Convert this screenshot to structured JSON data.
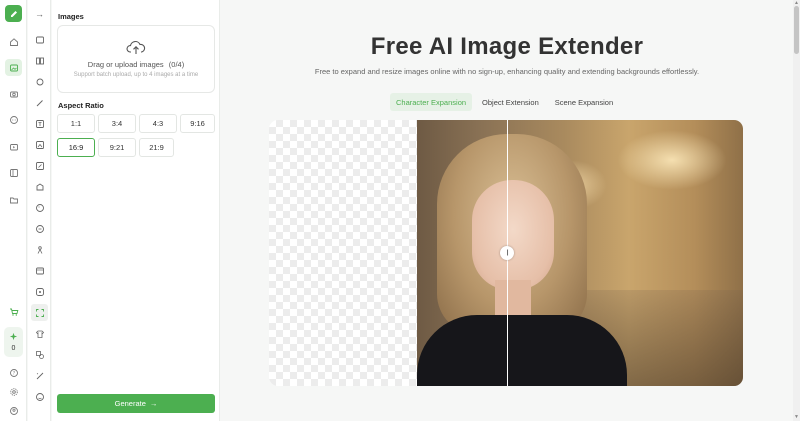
{
  "left_rail": {
    "credit_count": "0",
    "accent": "#4caf50"
  },
  "panel": {
    "images_title": "Images",
    "upload_text": "Drag or upload images",
    "upload_count": "(0/4)",
    "upload_hint": "Support batch upload, up to 4 images at a time",
    "aspect_title": "Aspect Ratio",
    "ratios": [
      "1:1",
      "3:4",
      "4:3",
      "9:16",
      "16:9",
      "9:21",
      "21:9"
    ],
    "selected_ratio": "16:9",
    "generate_label": "Generate",
    "generate_arrow": "→"
  },
  "main": {
    "title": "Free AI Image Extender",
    "subtitle": "Free to expand and resize images online with no sign-up, enhancing quality and extending backgrounds effortlessly.",
    "tabs": [
      "Character Expansion",
      "Object Extension",
      "Scene Expansion"
    ],
    "active_tab": "Character Expansion",
    "slider_handle": "||"
  },
  "tools_column": {
    "collapse_arrow": "→"
  }
}
